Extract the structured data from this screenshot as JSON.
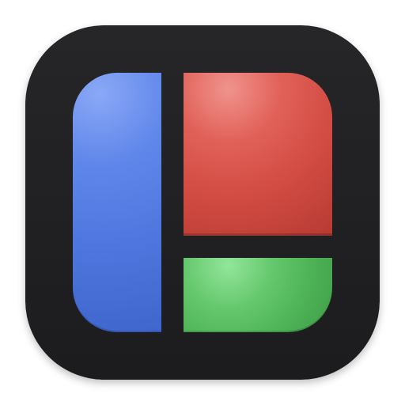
{
  "icon": {
    "name": "layout-grid-icon",
    "background_color": "#1f1f21",
    "panels": [
      {
        "id": "left",
        "color": "#5077dd"
      },
      {
        "id": "top-right",
        "color": "#d84f46"
      },
      {
        "id": "bottom-right",
        "color": "#55b95d"
      }
    ]
  }
}
